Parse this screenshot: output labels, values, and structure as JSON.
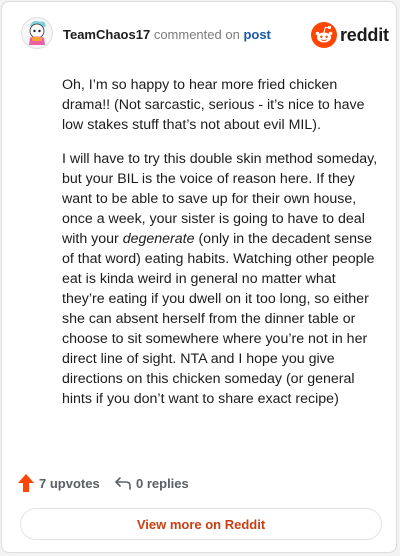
{
  "header": {
    "username": "TeamChaos17",
    "commented_on": "commented on",
    "post_link": "post",
    "logo_text": "reddit",
    "avatar_icon": "snoo-avatar-icon",
    "logo_icon": "reddit-snoo-logo-icon"
  },
  "comment": {
    "p1": "Oh, I’m so happy to hear more fried chicken drama!! (Not sarcastic, serious - it’s nice to have low stakes stuff that’s not about evil MIL).",
    "p2_before": "I will have to try this double skin method someday, but your BIL is the voice of reason here. If they want to be able to save up for their own house, once a week, your sister is going to have to deal with your ",
    "p2_em": "degenerate",
    "p2_after": " (only in the decadent sense of that word) eating habits. Watching other people eat is kinda weird in general no matter what they’re eating if you dwell on it too long, so either she can absent herself from the dinner table or choose to sit somewhere where you’re not in her direct line of sight. NTA and I hope you give directions on this chicken someday (or general hints if you don’t want to share exact recipe)"
  },
  "footer": {
    "upvotes": "7 upvotes",
    "replies": "0 replies",
    "upvote_icon": "upvote-arrow-icon",
    "reply_icon": "reply-arrow-icon"
  },
  "cta": {
    "label": "View more on Reddit"
  },
  "colors": {
    "brand": "#ff4500",
    "link": "#1a5aa6",
    "cta_text": "#c83f14"
  }
}
